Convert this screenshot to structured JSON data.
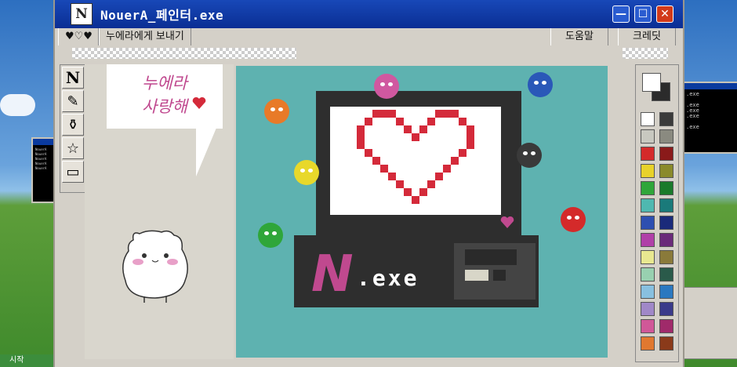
{
  "window": {
    "title": "NouerA_페인터.exe",
    "app_icon": "N"
  },
  "title_controls": {
    "minimize": "—",
    "maximize": "☐",
    "close": "✕"
  },
  "menu": {
    "hearts": "♥♡♥",
    "send": "누에라에게 보내기",
    "help": "도움말",
    "credits": "크레딧"
  },
  "tools": [
    {
      "name": "text-tool-icon",
      "glyph": "N"
    },
    {
      "name": "pencil-tool-icon",
      "glyph": "✎"
    },
    {
      "name": "spray-tool-icon",
      "glyph": "⚱"
    },
    {
      "name": "star-tool-icon",
      "glyph": "☆"
    },
    {
      "name": "eraser-tool-icon",
      "glyph": "▭"
    }
  ],
  "bubble": {
    "line1": "누에라",
    "line2": "사랑해"
  },
  "canvas": {
    "logo_letter": "N",
    "logo_text": ".exe"
  },
  "side_window": {
    "text": "NouerA\nNouerA\nNouerA\nNouerA\nNouerA"
  },
  "right_window": {
    "text": ".exe\n\n.exe\n.exe\n.exe\n\n.exe"
  },
  "taskbar": {
    "start": "시작"
  },
  "palette": {
    "primary": "#ffffff",
    "secondary": "#2b2b2b",
    "left": [
      "#ffffff",
      "#c8c8c0",
      "#d42a2a",
      "#e8d22a",
      "#2fa63a",
      "#4fb8b0",
      "#2d4fb0",
      "#b040a8",
      "#e8e890",
      "#98d0b0",
      "#88c0e0",
      "#a088c8",
      "#d05898",
      "#e07830"
    ],
    "right": [
      "#3a3a3a",
      "#8a8a80",
      "#8a1a1a",
      "#8a8a2a",
      "#1a7a2a",
      "#1a7a7a",
      "#1a2a7a",
      "#6a2a7a",
      "#8a7a3a",
      "#2a5a4a",
      "#2a78c0",
      "#3a3a8a",
      "#a02a6a",
      "#8a3a1a"
    ]
  },
  "colors": {
    "title_bar": "#0a2e94",
    "canvas_bg": "#5eb2b0",
    "heart": "#d42a3a",
    "logo_pink": "#c0498f"
  }
}
